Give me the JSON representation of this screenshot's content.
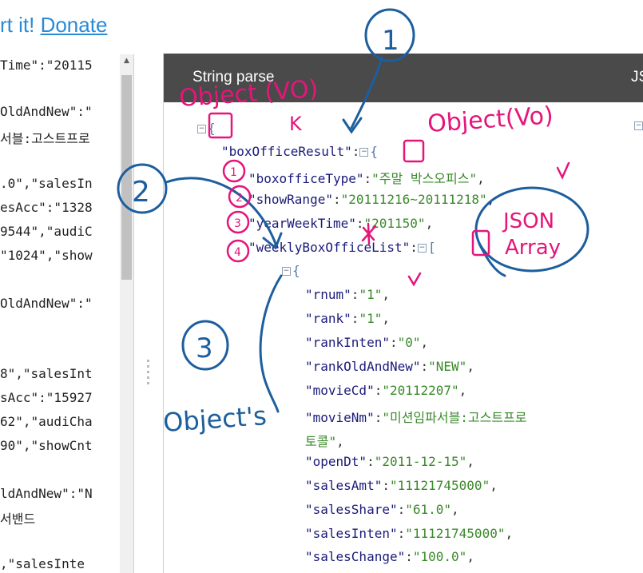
{
  "top_banner": {
    "prefix": "rt it! ",
    "donate": "Donate"
  },
  "left_pane": {
    "lines": [
      "Time\":\"20115",
      "OldAndNew\":\"",
      "서블:고스트프로",
      ".0\",\"salesIn",
      "esAcc\":\"1328",
      "9544\",\"audiC",
      "\"1024\",\"show",
      "OldAndNew\":\"",
      "8\",\"salesInt",
      "sAcc\":\"15927",
      "62\",\"audiCha",
      "90\",\"showCnt",
      "ldAndNew\":\"N",
      "서밴드",
      ",\"salesInte"
    ]
  },
  "panel": {
    "title": "String parse",
    "title2": "JS"
  },
  "json_view": {
    "root_brace": "{",
    "box_office_result_key": "\"boxOfficeResult\"",
    "inner_brace": "{",
    "fields": [
      {
        "key": "\"boxofficeType\"",
        "value": "\"주말 박스오피스\""
      },
      {
        "key": "\"showRange\"",
        "value": "\"20111216~20111218\""
      },
      {
        "key": "\"yearWeekTime\"",
        "value": "\"201150\""
      }
    ],
    "list_key": "\"weeklyBoxOfficeList\"",
    "array_bracket": "[",
    "item_brace": "{",
    "items": [
      {
        "key": "\"rnum\"",
        "value": "\"1\""
      },
      {
        "key": "\"rank\"",
        "value": "\"1\""
      },
      {
        "key": "\"rankInten\"",
        "value": "\"0\""
      },
      {
        "key": "\"rankOldAndNew\"",
        "value": "\"NEW\""
      },
      {
        "key": "\"movieCd\"",
        "value": "\"20112207\""
      },
      {
        "key": "\"movieNm\"",
        "value": "\"미션임파서블:고스트프로"
      },
      {
        "key": "",
        "value": "토콜\""
      },
      {
        "key": "\"openDt\"",
        "value": "\"2011-12-15\""
      },
      {
        "key": "\"salesAmt\"",
        "value": "\"11121745000\""
      },
      {
        "key": "\"salesShare\"",
        "value": "\"61.0\""
      },
      {
        "key": "\"salesInten\"",
        "value": "\"11121745000\""
      },
      {
        "key": "\"salesChange\"",
        "value": "\"100.0\""
      }
    ]
  },
  "annotations": {
    "object_vo_1": "Object (VO)",
    "k": "K",
    "object_vo_2": "Object(Vo)",
    "json_array": [
      "JSON",
      "Array"
    ],
    "num1": "1",
    "num2": "2",
    "num3": "3",
    "objects": "Object's",
    "circle_nums": [
      "1",
      "2",
      "3",
      "4"
    ],
    "colors": {
      "pink": "#e5157a",
      "blue": "#1c5e9e"
    }
  }
}
